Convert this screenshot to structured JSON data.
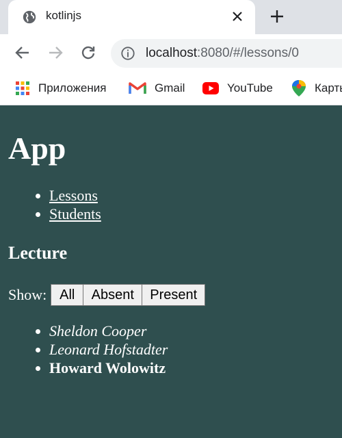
{
  "browser": {
    "tab_title": "kotlinjs",
    "address": {
      "host": "localhost",
      "rest": ":8080/#/lessons/0"
    },
    "bookmarks": [
      {
        "label": "Приложения",
        "icon": "apps-grid-icon"
      },
      {
        "label": "Gmail",
        "icon": "gmail-icon"
      },
      {
        "label": "YouTube",
        "icon": "youtube-icon"
      },
      {
        "label": "Карты",
        "icon": "maps-icon"
      }
    ]
  },
  "page": {
    "title": "App",
    "nav": [
      "Lessons",
      "Students"
    ],
    "lesson_title": "Lecture",
    "filter_label": "Show:",
    "filter_buttons": [
      "All",
      "Absent",
      "Present"
    ],
    "students": [
      {
        "name": "Sheldon Cooper",
        "status": "absent"
      },
      {
        "name": "Leonard Hofstadter",
        "status": "absent"
      },
      {
        "name": "Howard Wolowitz",
        "status": "present"
      }
    ]
  },
  "colors": {
    "page_background": "#2f4f4f",
    "text": "#ffffff"
  }
}
